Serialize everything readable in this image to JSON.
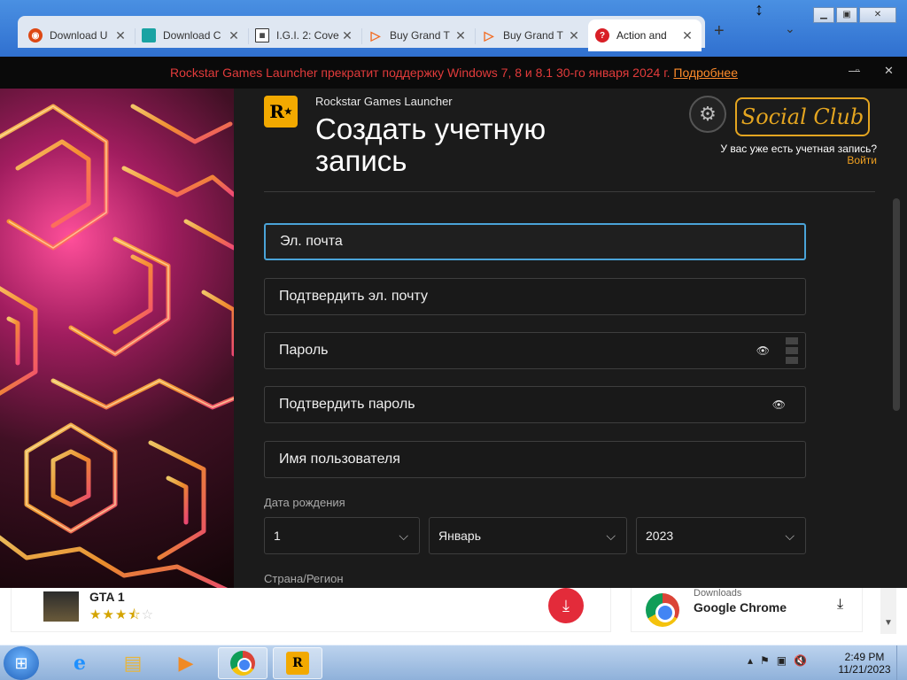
{
  "browser": {
    "tabs": [
      {
        "label": "Download U",
        "fav": "ubuntu-icon",
        "color": "#dd4814"
      },
      {
        "label": "Download C",
        "fav": "diamond-icon",
        "color": "#1aa3a3"
      },
      {
        "label": "I.G.I. 2: Cove",
        "fav": "qr-icon",
        "color": "#333333"
      },
      {
        "label": "Buy Grand T",
        "fav": "play-icon",
        "color": "#f26b21"
      },
      {
        "label": "Buy Grand T",
        "fav": "play-icon",
        "color": "#f26b21"
      },
      {
        "label": "Action and",
        "fav": "location-icon",
        "color": "#d81f26"
      }
    ],
    "new_tab": "+",
    "tab_menu": "⌄"
  },
  "launcher": {
    "banner_text": "Rockstar Games Launcher прекратит поддержку Windows 7, 8 и 8.1 30-го января 2024 г.",
    "banner_link": "Подробнее",
    "app_name": "Rockstar Games Launcher",
    "title": "Создать учетную запись",
    "social_club": "Social Club",
    "have_account": "У вас уже есть учетная запись?",
    "login": "Войти",
    "fields": {
      "email": "Эл. почта",
      "confirm_email": "Подтвердить эл. почту",
      "password": "Пароль",
      "confirm_password": "Подтвердить пароль",
      "username": "Имя пользователя"
    },
    "dob_label": "Дата рождения",
    "dob": {
      "day": "1",
      "month": "Январь",
      "year": "2023"
    },
    "country_label": "Страна/Регион"
  },
  "page": {
    "gta_title": "GTA 1",
    "rating_stars": 3.5,
    "download_category": "Downloads",
    "download_name": "Google Chrome"
  },
  "taskbar": {
    "time": "2:49 PM",
    "date": "11/21/2023"
  }
}
